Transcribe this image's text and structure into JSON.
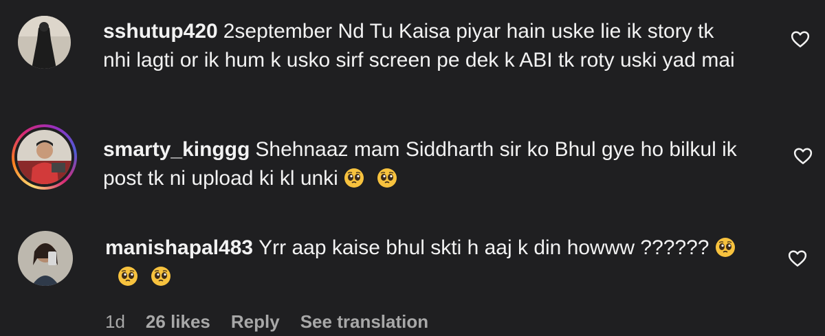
{
  "comments": [
    {
      "username": "sshutup420",
      "text": "2september Nd Tu Kaisa piyar hain uske lie ik story tk nhi lagti or ik hum k usko sirf screen pe dek k ABI tk roty uski yad mai",
      "has_story": false,
      "emoji_count": 0
    },
    {
      "username": "smarty_kinggg",
      "text": "Shehnaaz mam Siddharth sir ko Bhul gye ho bilkul ik post tk ni upload ki kl unki",
      "has_story": true,
      "emoji_count": 2
    },
    {
      "username": "manishapal483",
      "text": "Yrr aap kaise bhul skti h aaj k din howww ??????",
      "has_story": false,
      "emoji_count": 3
    }
  ],
  "meta": {
    "age": "1d",
    "likes": "26 likes",
    "reply_label": "Reply",
    "translate_label": "See translation"
  },
  "icons": {
    "like": "heart-outline-icon",
    "emoji": "pleading-face-emoji"
  },
  "colors": {
    "background": "#1f1f21",
    "text": "#f2f2f2",
    "muted": "#a8a8a8",
    "emoji": "#f7c23e"
  }
}
